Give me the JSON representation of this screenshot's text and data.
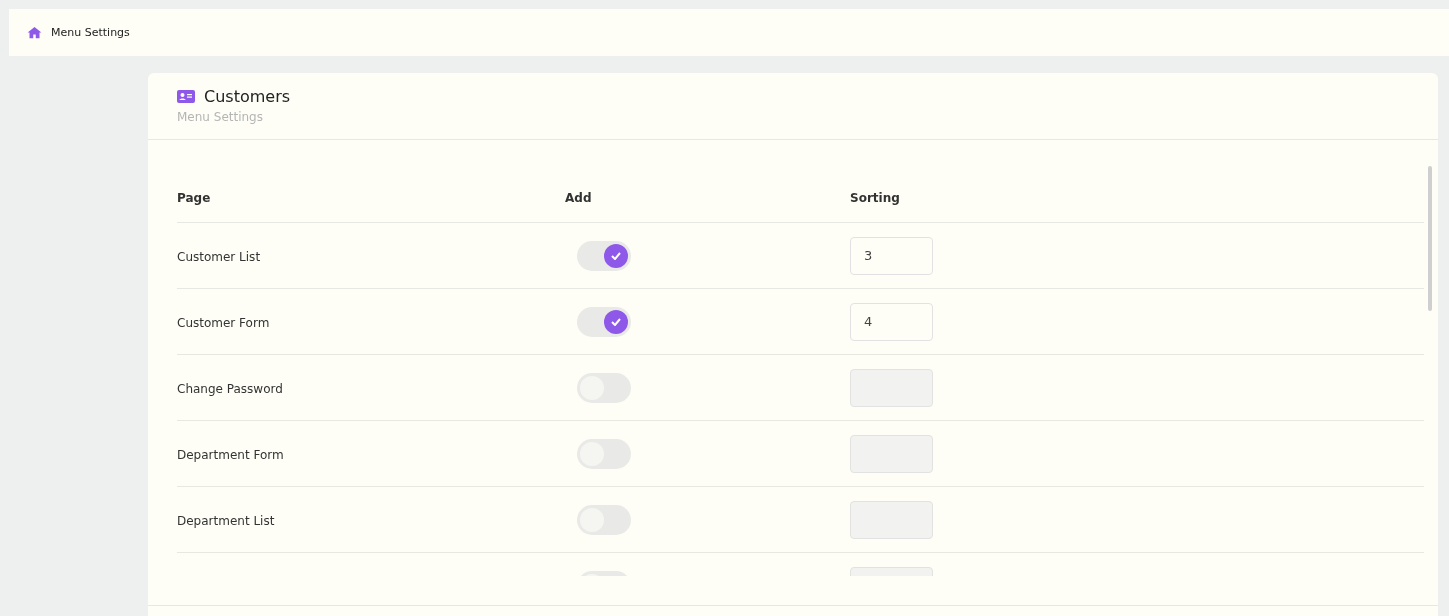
{
  "breadcrumb": {
    "title": "Menu Settings"
  },
  "card": {
    "title": "Customers",
    "subtitle": "Menu Settings"
  },
  "table": {
    "columns": [
      "Page",
      "Add",
      "Sorting"
    ],
    "rows": [
      {
        "page": "Customer List",
        "on": true,
        "sorting": "3"
      },
      {
        "page": "Customer Form",
        "on": true,
        "sorting": "4"
      },
      {
        "page": "Change Password",
        "on": false
      },
      {
        "page": "Department Form",
        "on": false
      },
      {
        "page": "Department List",
        "on": false
      },
      {
        "on": false
      }
    ]
  }
}
